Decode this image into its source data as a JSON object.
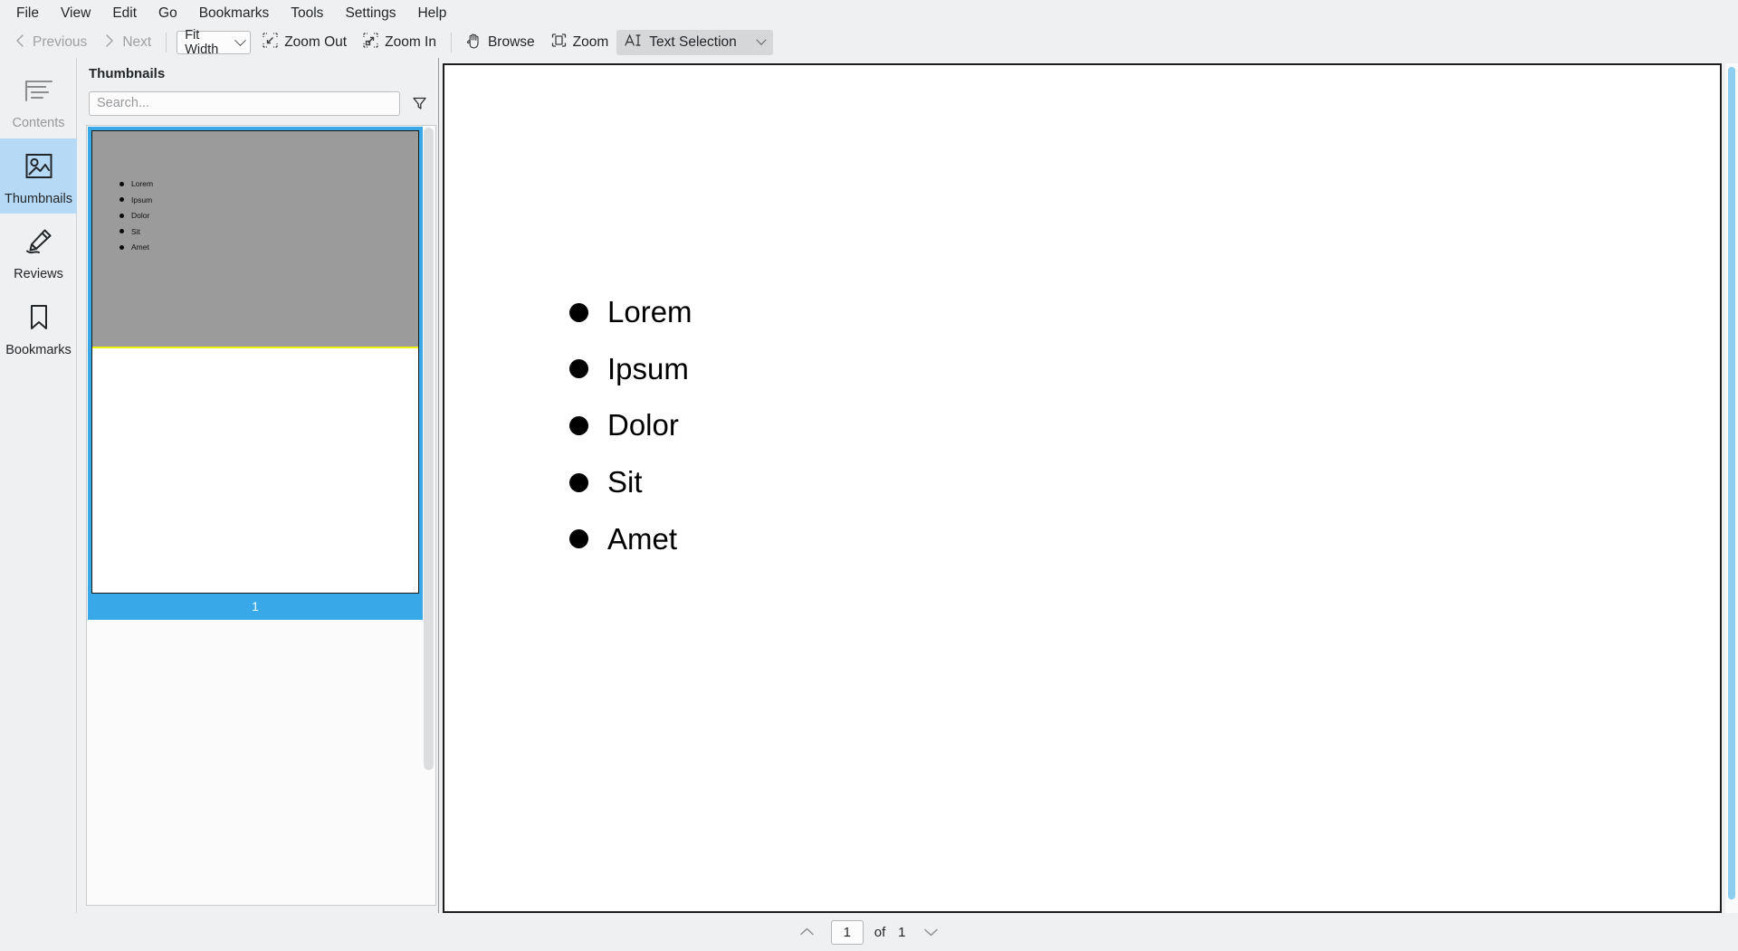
{
  "menubar": {
    "items": [
      {
        "label": "File"
      },
      {
        "label": "View"
      },
      {
        "label": "Edit"
      },
      {
        "label": "Go"
      },
      {
        "label": "Bookmarks"
      },
      {
        "label": "Tools"
      },
      {
        "label": "Settings"
      },
      {
        "label": "Help"
      }
    ]
  },
  "toolbar": {
    "previous_label": "Previous",
    "next_label": "Next",
    "zoom_mode": "Fit Width",
    "zoom_out_label": "Zoom Out",
    "zoom_in_label": "Zoom In",
    "browse_label": "Browse",
    "zoom_label": "Zoom",
    "text_selection_label": "Text Selection"
  },
  "rail": {
    "items": [
      {
        "label": "Contents",
        "icon": "contents-icon",
        "selected": false,
        "enabled": false
      },
      {
        "label": "Thumbnails",
        "icon": "thumbnails-icon",
        "selected": true,
        "enabled": true
      },
      {
        "label": "Reviews",
        "icon": "reviews-icon",
        "selected": false,
        "enabled": true
      },
      {
        "label": "Bookmarks",
        "icon": "bookmarks-icon",
        "selected": false,
        "enabled": true
      }
    ]
  },
  "thumbnails_panel": {
    "title": "Thumbnails",
    "search_placeholder": "Search...",
    "search_value": "",
    "filter_icon": "filter-funnel-icon",
    "pages": [
      {
        "number": "1",
        "selected": true,
        "selection_color": "#38a8e8",
        "highlight_color": "#9b9b9b",
        "highlight_border_color": "#f2f20c",
        "items": [
          "Lorem",
          "Ipsum",
          "Dolor",
          "Sit",
          "Amet"
        ]
      }
    ]
  },
  "document": {
    "items": [
      "Lorem",
      "Ipsum",
      "Dolor",
      "Sit",
      "Amet"
    ]
  },
  "statusbar": {
    "prev_page_icon": "chevron-up-icon",
    "next_page_icon": "chevron-down-icon",
    "current_page": "1",
    "of_label": "of",
    "total_pages": "1"
  },
  "colors": {
    "accent": "#38a8e8",
    "rail_selected": "#b6daf5",
    "scrollbar_doc": "#8ccdf0",
    "chrome": "#eff0f1"
  }
}
